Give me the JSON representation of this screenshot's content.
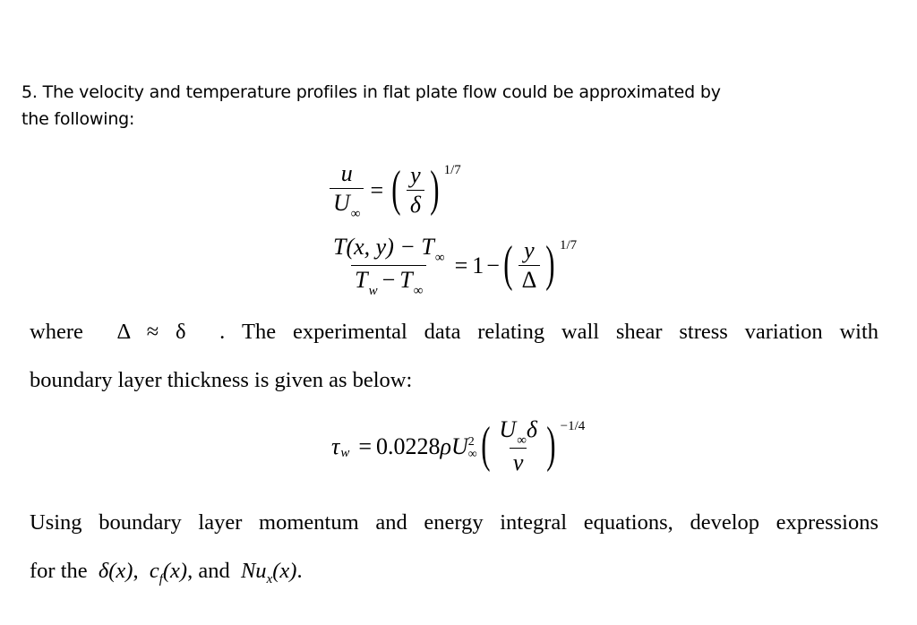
{
  "document": {
    "heading": {
      "line1": "5. The velocity and temperature profiles in flat plate flow could be approximated by",
      "line2": "the following:"
    },
    "equation1": {
      "lhs_num": "u",
      "lhs_den": "U",
      "lhs_den_sub": "∞",
      "equals": "=",
      "rhs_num": "y",
      "rhs_den": "δ",
      "exponent": "1/7"
    },
    "equation2": {
      "lhs_num": "T(x, y) − T",
      "lhs_num_sub": "∞",
      "lhs_den_a": "T",
      "lhs_den_a_sub": "w",
      "lhs_den_minus": "−",
      "lhs_den_b": "T",
      "lhs_den_b_sub": "∞",
      "equals": "=",
      "one": "1",
      "minus": "−",
      "rhs_num": "y",
      "rhs_den": "Δ",
      "exponent": "1/7"
    },
    "paragraph1": {
      "where": "where",
      "condition": "Δ ≈ δ",
      "rest_line1": ". The experimental data relating wall shear stress variation with",
      "line2": "boundary layer thickness is given as below:"
    },
    "equation3": {
      "lhs": "τ",
      "lhs_sub": "w",
      "equals": "=",
      "coefficient": "0.0228",
      "rho": "ρ",
      "U": "U",
      "U_sup": "2",
      "U_sub": "∞",
      "frac_num": "U",
      "frac_num_sub": "∞",
      "frac_num_delta": "δ",
      "frac_den": "ν",
      "exponent": "−1/4"
    },
    "paragraph2": {
      "line1": "Using boundary layer momentum and energy integral equations, develop expressions",
      "for_the": "for the",
      "delta_x": "δ(x)",
      "comma1": ",",
      "cf": "c",
      "cf_sub": "f",
      "cf_arg": "(x)",
      "and": ", and",
      "nu": "Nu",
      "nu_sub": "x",
      "nu_arg": "(x)",
      "period": "."
    }
  }
}
